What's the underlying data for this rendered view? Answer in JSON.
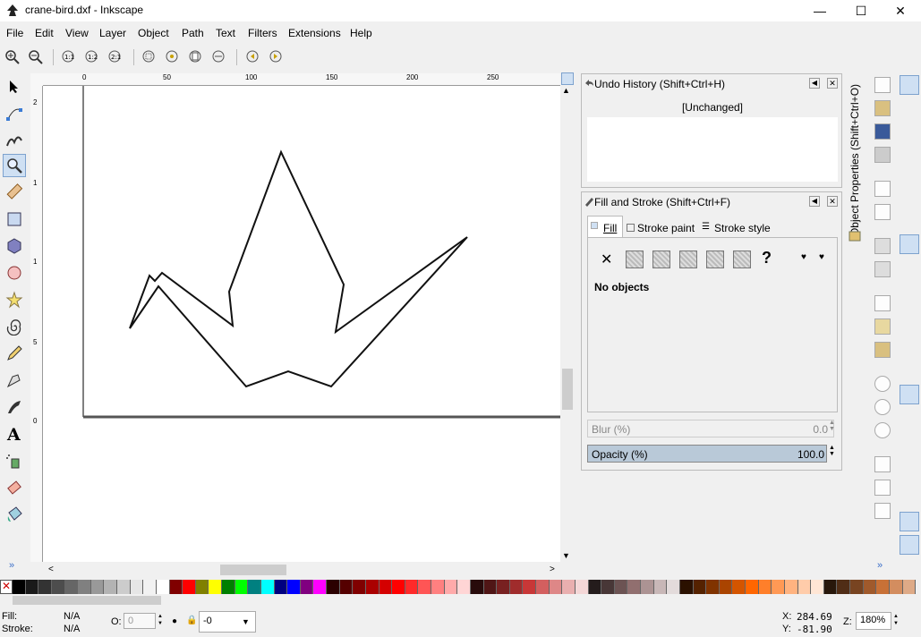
{
  "window": {
    "title": "crane-bird.dxf - Inkscape"
  },
  "menu": [
    "File",
    "Edit",
    "View",
    "Layer",
    "Object",
    "Path",
    "Text",
    "Filters",
    "Extensions",
    "Help"
  ],
  "ruler": {
    "h_ticks": [
      "0",
      "50",
      "100",
      "150",
      "200",
      "250"
    ],
    "v_ticks": [
      "2",
      "1",
      "1",
      "5",
      "0"
    ]
  },
  "undo_panel": {
    "title": "Undo History (Shift+Ctrl+H)",
    "entry": "[Unchanged]"
  },
  "fill_panel": {
    "title": "Fill and Stroke (Shift+Ctrl+F)",
    "tabs": [
      "Fill",
      "Stroke paint",
      "Stroke style"
    ],
    "message": "No objects",
    "unset_glyph": "?",
    "blur_label": "Blur (%)",
    "blur_value": "0.0",
    "opacity_label": "Opacity (%)",
    "opacity_value": "100.0"
  },
  "side_tab": "Object Properties (Shift+Ctrl+O)",
  "status": {
    "fill_label": "Fill:",
    "fill_value": "N/A",
    "stroke_label": "Stroke:",
    "stroke_value": "N/A",
    "opacity_label": "O:",
    "opacity_value": "0",
    "layer_value": "-0",
    "x_label": "X:",
    "x_value": "284.69",
    "y_label": "Y:",
    "y_value": "-81.90",
    "z_label": "Z:",
    "zoom_value": "180%"
  },
  "palette_colors": [
    "#000000",
    "#1a1a1a",
    "#333333",
    "#4d4d4d",
    "#666666",
    "#808080",
    "#999999",
    "#b3b3b3",
    "#cccccc",
    "#e6e6e6",
    "#f2f2f2",
    "#ffffff",
    "#800000",
    "#ff0000",
    "#808000",
    "#ffff00",
    "#008000",
    "#00ff00",
    "#008080",
    "#00ffff",
    "#000080",
    "#0000ff",
    "#800080",
    "#ff00ff",
    "#2b0000",
    "#550000",
    "#800000",
    "#aa0000",
    "#d40000",
    "#ff0000",
    "#ff2a2a",
    "#ff5555",
    "#ff8080",
    "#ffaaaa",
    "#ffd5d5",
    "#280b0b",
    "#501616",
    "#782121",
    "#a02c2c",
    "#c83737",
    "#d35f5f",
    "#de8787",
    "#e9afaf",
    "#f4d7d7",
    "#241c1c",
    "#483737",
    "#6c5353",
    "#916f6f",
    "#ac9393",
    "#c8b7b7",
    "#e3dbdb",
    "#2b1100",
    "#552200",
    "#803300",
    "#aa4400",
    "#d45500",
    "#ff6600",
    "#ff7f2a",
    "#ff9955",
    "#ffb380",
    "#ffccaa",
    "#ffe6d5",
    "#28170b",
    "#502d16",
    "#784421",
    "#a05a2c",
    "#c87137",
    "#d38d5f",
    "#deaa87"
  ]
}
